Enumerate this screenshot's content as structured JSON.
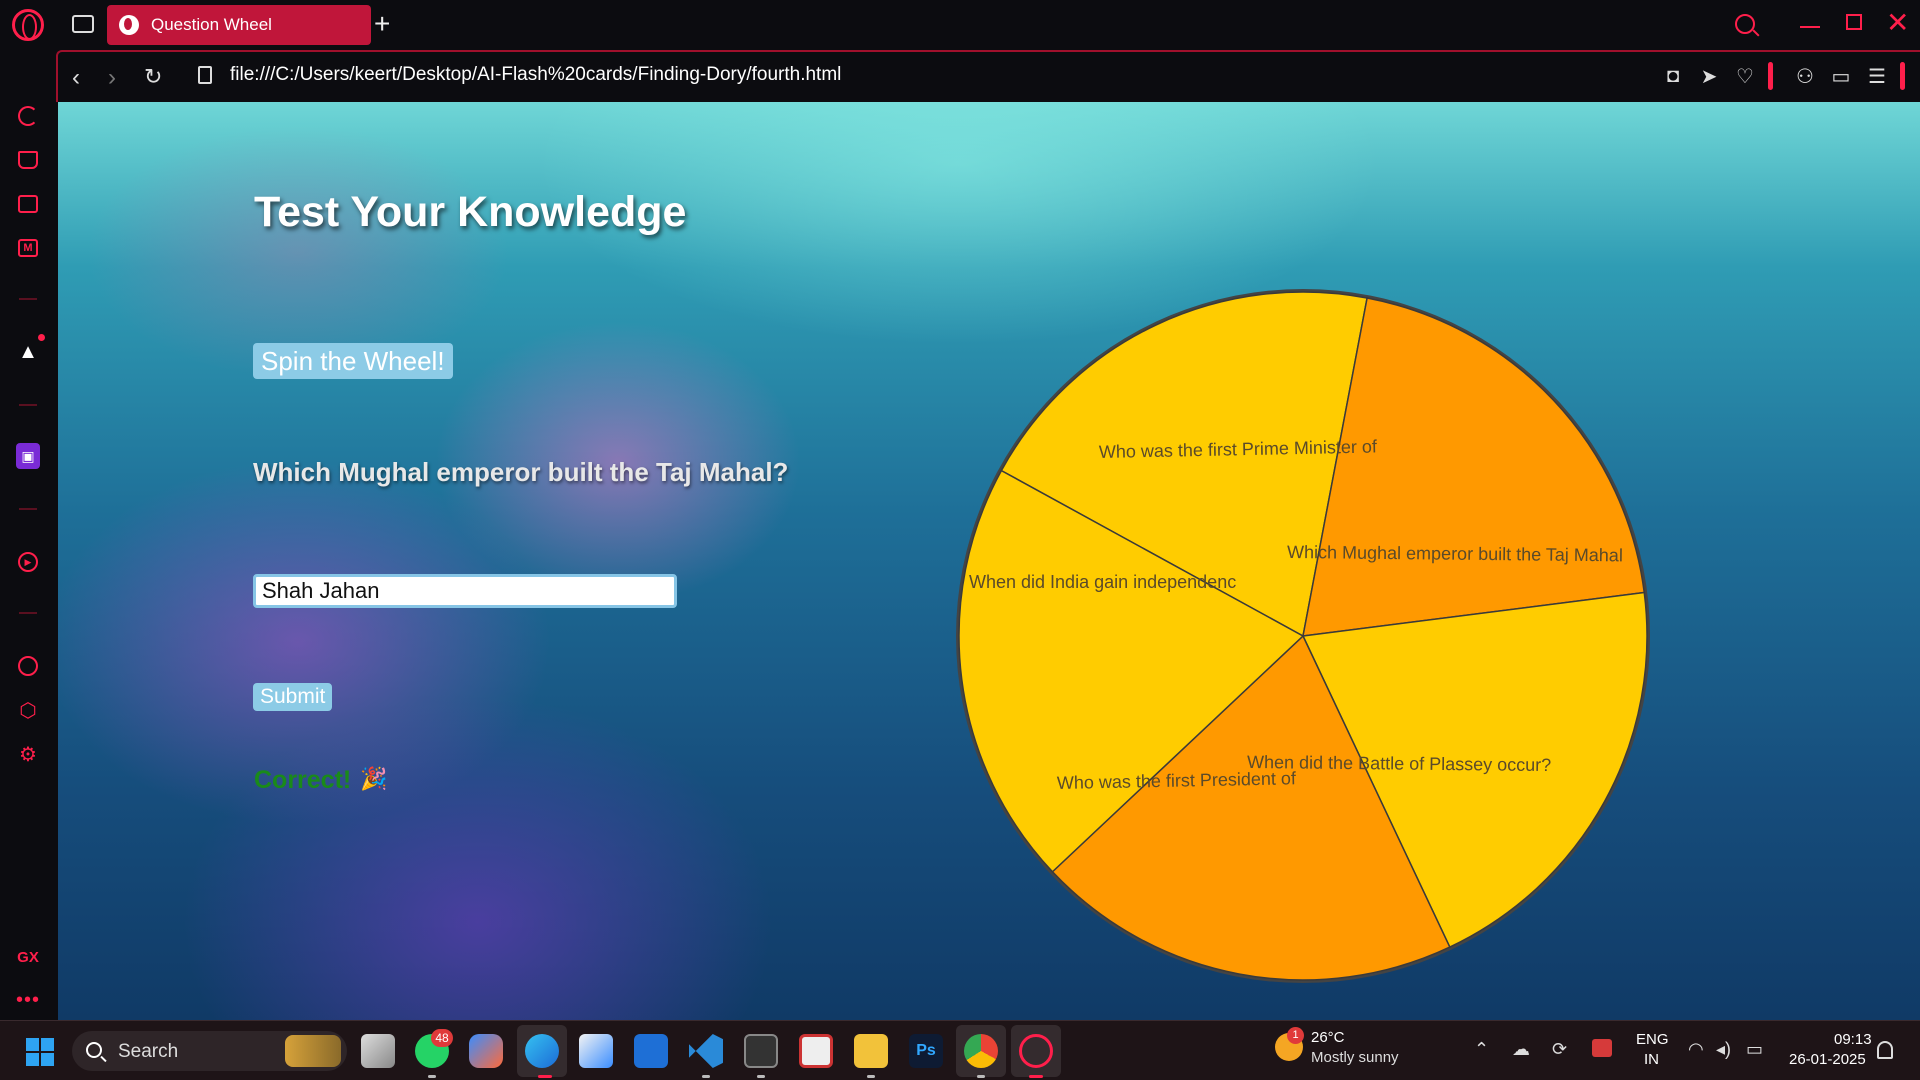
{
  "browser": {
    "tab_title": "Question Wheel",
    "url": "file:///C:/Users/keert/Desktop/AI-Flash%20cards/Finding-Dory/fourth.html",
    "accent_color": "#ff1f4b"
  },
  "sidebar": {
    "items": [
      "reload-icon",
      "shopping-icon",
      "screen-icon",
      "m-icon",
      "aria-icon",
      "twitch-icon",
      "player-icon",
      "history-icon",
      "extensions-icon",
      "settings-icon"
    ],
    "gx_label": "GX",
    "more_label": "•••"
  },
  "page": {
    "title": "Test Your Knowledge",
    "spin_button": "Spin the Wheel!",
    "question": "Which Mughal emperor built the Taj Mahal?",
    "answer_value": "Shah Jahan",
    "submit_button": "Submit",
    "result": "Correct!",
    "result_emoji": "🎉",
    "result_color": "#1a8a1a"
  },
  "wheel": {
    "colors": [
      "#ffcc00",
      "#ff9900"
    ],
    "border_color": "#444444",
    "segments": [
      "Who was the first Prime Minister of",
      "Which Mughal emperor built the Taj Mahal",
      "When did the Battle of Plassey occur?",
      "Who was the first President of",
      "When did India gain independenc"
    ]
  },
  "taskbar": {
    "search_label": "Search",
    "whatsapp_badge": "48",
    "weather_badge": "1",
    "weather_temp": "26°C",
    "weather_desc": "Mostly sunny",
    "lang_line1": "ENG",
    "lang_line2": "IN",
    "time": "09:13",
    "date": "26-01-2025"
  }
}
